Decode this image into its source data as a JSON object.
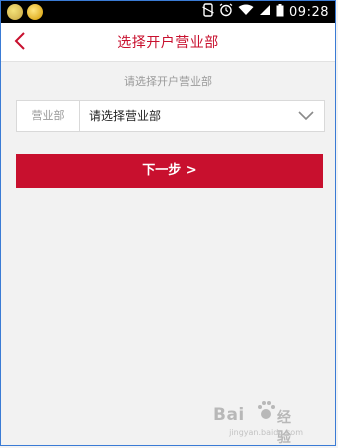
{
  "status_bar": {
    "time": "09:28",
    "icons": [
      "app-icon-wechat",
      "app-icon-notification",
      "rotate-icon",
      "alarm-icon",
      "wifi-icon",
      "signal-icon",
      "battery-icon"
    ]
  },
  "header": {
    "back_icon": "chevron-left-icon",
    "title": "选择开户营业部"
  },
  "main": {
    "subtitle": "请选择开户营业部",
    "branch_select": {
      "label": "营业部",
      "value": "请选择营业部",
      "icon": "chevron-down-icon"
    },
    "next_button": "下一步 >"
  },
  "watermark": {
    "text": "Bai",
    "text2": "经验",
    "sub": "jingyan.baidu.com"
  },
  "colors": {
    "accent": "#c8102e",
    "background": "#f2f2f2",
    "muted_text": "#9a9a9a"
  }
}
